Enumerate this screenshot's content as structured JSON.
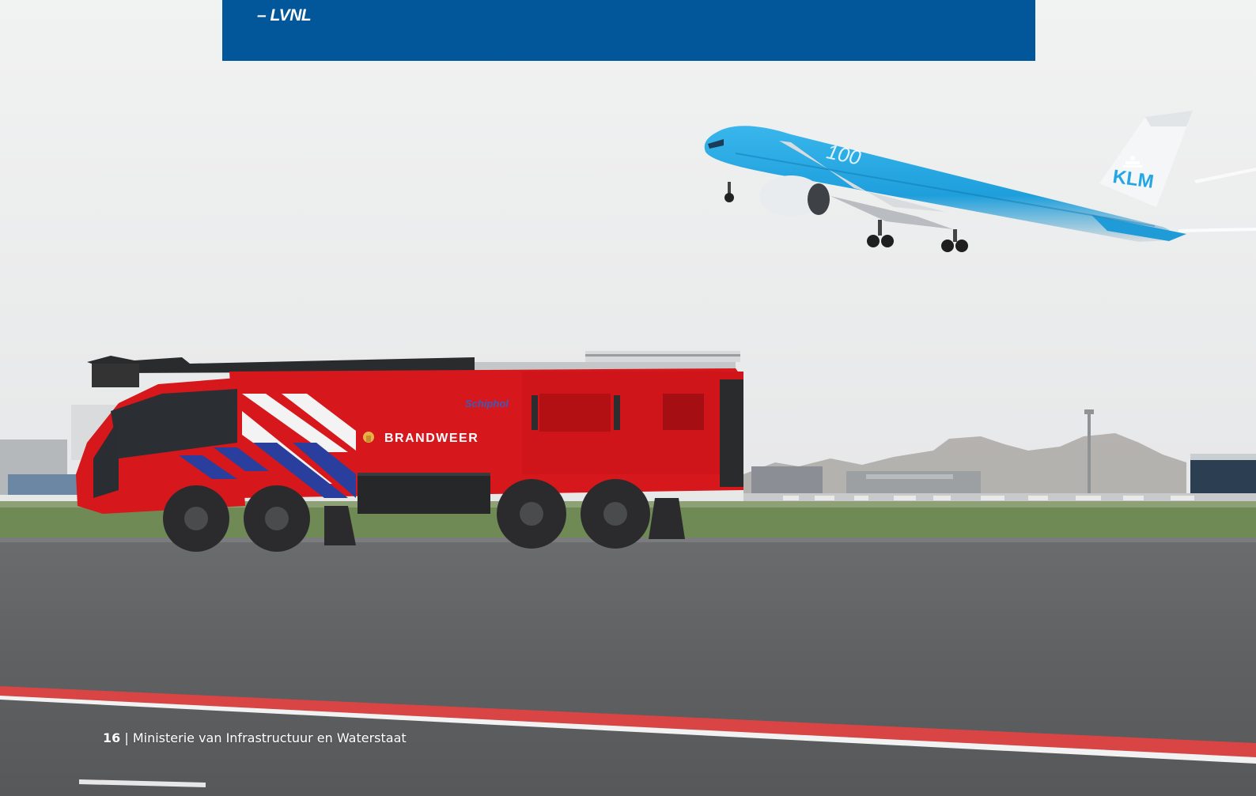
{
  "quote": {
    "source": "– LVNL"
  },
  "photo": {
    "truck_lettering": "BRANDWEER",
    "truck_badge": "Schiphol",
    "aircraft_lettering": "KLM",
    "aircraft_livery": "100"
  },
  "footer": {
    "page_number": "16",
    "separator": " | ",
    "publisher": "Ministerie van Infrastructuur en Waterstaat"
  },
  "colors": {
    "quote_background": "#01579a",
    "truck_red": "#d5171b",
    "klm_blue": "#23a6e3",
    "runway": "#5d5f61"
  },
  "icons": [
    "klm-crown-icon",
    "brandweer-emblem-icon"
  ]
}
